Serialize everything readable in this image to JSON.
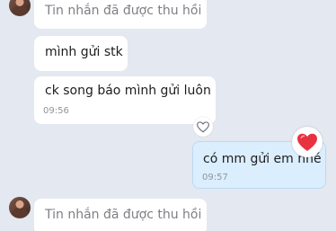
{
  "messages": [
    {
      "sender": "other",
      "text": "Tin nhắn đã được thu hồi",
      "recalled": true
    },
    {
      "sender": "other",
      "text": "mình gửi stk"
    },
    {
      "sender": "other",
      "text": "ck song báo mình gửi luôn",
      "time": "09:56"
    },
    {
      "sender": "me",
      "text": "có mm gửi em nhé",
      "time": "09:57",
      "reaction": "heart-icon"
    },
    {
      "sender": "other",
      "text": "Tin nhắn đã được thu hồi",
      "recalled": true
    }
  ],
  "colors": {
    "background": "#e3e8f1",
    "incoming_bubble": "#ffffff",
    "outgoing_bubble": "#dbeefd",
    "recalled_text": "#7d7f84",
    "timestamp": "#8f959e",
    "reaction_heart": "#e8323f"
  }
}
